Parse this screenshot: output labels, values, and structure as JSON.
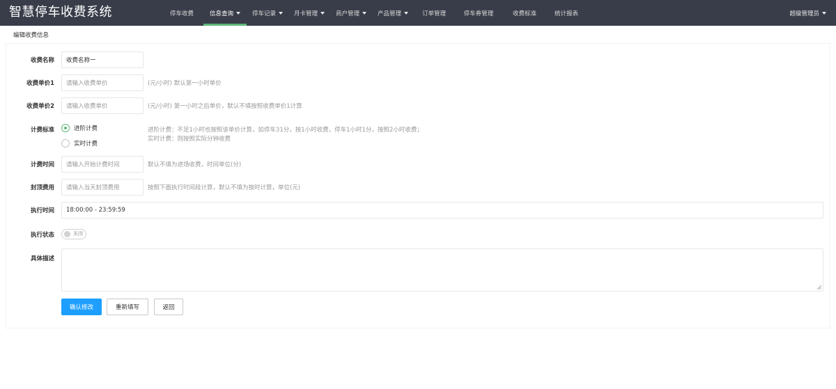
{
  "app": {
    "title": "智慧停车收费系统"
  },
  "nav": {
    "items": [
      {
        "label": "停车收费",
        "dropdown": false,
        "active": false
      },
      {
        "label": "信息查询",
        "dropdown": true,
        "active": true
      },
      {
        "label": "停车记录",
        "dropdown": true,
        "active": false
      },
      {
        "label": "月卡管理",
        "dropdown": true,
        "active": false
      },
      {
        "label": "商户管理",
        "dropdown": true,
        "active": false
      },
      {
        "label": "产品管理",
        "dropdown": true,
        "active": false
      },
      {
        "label": "订单管理",
        "dropdown": false,
        "active": false
      },
      {
        "label": "停车券管理",
        "dropdown": false,
        "active": false
      },
      {
        "label": "收费标准",
        "dropdown": false,
        "active": false
      },
      {
        "label": "统计报表",
        "dropdown": false,
        "active": false
      }
    ],
    "user": "超级管理员"
  },
  "page": {
    "subtitle": "编辑收费信息"
  },
  "form": {
    "name": {
      "label": "收费名称",
      "value": "收费名称一"
    },
    "price1": {
      "label": "收费单价1",
      "placeholder": "请输入收费单价",
      "hint": "(元/小时) 默认第一小时单价"
    },
    "price2": {
      "label": "收费单价2",
      "placeholder": "请输入收费单价",
      "hint": "(元/小时) 第一小时之后单价，默认不填按照收费单价1计算"
    },
    "standard": {
      "label": "计费标准",
      "options": [
        {
          "label": "进阶计费",
          "selected": true
        },
        {
          "label": "实时计费",
          "selected": false
        }
      ],
      "hint1": "进阶计费：不足1小时也按照该单价计算，如停车31分，按1小时收费，停车1小时1分，按照2小时收费；",
      "hint2": "实时计费：则按照实际分钟收费"
    },
    "start_time": {
      "label": "计费时间",
      "placeholder": "请输入开始计费时间",
      "hint": "默认不填为进场收费，时间单位(分)"
    },
    "cap": {
      "label": "封顶费用",
      "placeholder": "请输入当天封顶费用",
      "hint": "按照下面执行时间段计算，默认不填为按时计算，单位(元)"
    },
    "exec_time": {
      "label": "执行时间",
      "value": "18:00:00 - 23:59:59"
    },
    "exec_status": {
      "label": "执行状态",
      "switch_text": "关闭",
      "on": false
    },
    "description": {
      "label": "具体描述",
      "value": ""
    },
    "buttons": {
      "confirm": "确认修改",
      "reset": "重新填写",
      "back": "返回"
    }
  },
  "colors": {
    "header_bg": "#393d49",
    "active_underline": "#5fb878",
    "primary": "#1e9fff"
  }
}
